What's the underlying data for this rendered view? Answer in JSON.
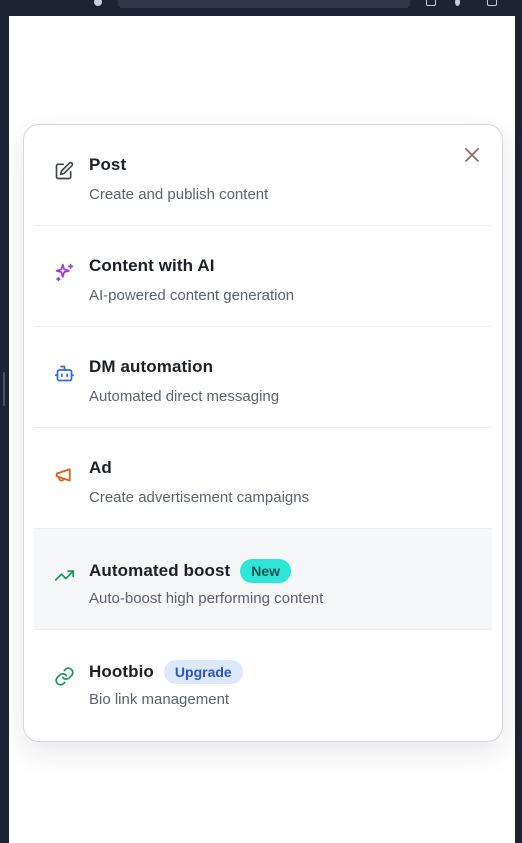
{
  "menu": {
    "close_icon": "close-icon",
    "items": [
      {
        "title": "Post",
        "description": "Create and publish content",
        "icon": "edit-icon",
        "icon_color": "#3f4653"
      },
      {
        "title": "Content with AI",
        "description": "AI-powered content generation",
        "icon": "sparkles-icon",
        "icon_color": "#9b3fe0"
      },
      {
        "title": "DM automation",
        "description": "Automated direct messaging",
        "icon": "bot-icon",
        "icon_color": "#2f6fd6"
      },
      {
        "title": "Ad",
        "description": "Create advertisement campaigns",
        "icon": "megaphone-icon",
        "icon_color": "#e0601a"
      },
      {
        "title": "Automated boost",
        "description": "Auto-boost high performing content",
        "icon": "trending-up-icon",
        "icon_color": "#169a5a",
        "badge": "New"
      },
      {
        "title": "Hootbio",
        "description": "Bio link management",
        "icon": "link-icon",
        "icon_color": "#169a5a",
        "badge": "Upgrade"
      }
    ]
  },
  "colors": {
    "badge_new_bg": "#2ee6d6",
    "badge_upgrade_bg": "#dde8fb",
    "close_icon": "#8a7067"
  }
}
